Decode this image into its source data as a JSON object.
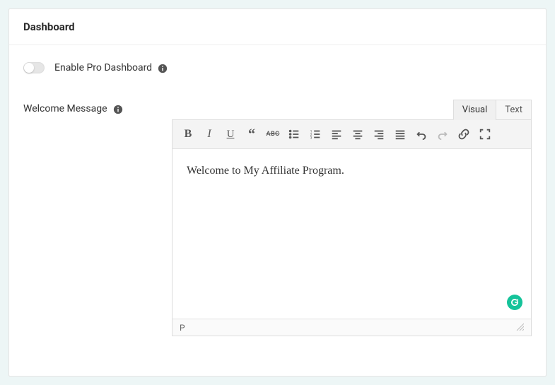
{
  "header": {
    "title": "Dashboard"
  },
  "options": {
    "enable_pro": {
      "label": "Enable Pro Dashboard",
      "checked": false
    },
    "welcome_message": {
      "label": "Welcome Message"
    }
  },
  "editor": {
    "tabs": {
      "visual": "Visual",
      "text": "Text",
      "active": "visual"
    },
    "content": "Welcome to My Affiliate Program.",
    "status_path": "P"
  }
}
